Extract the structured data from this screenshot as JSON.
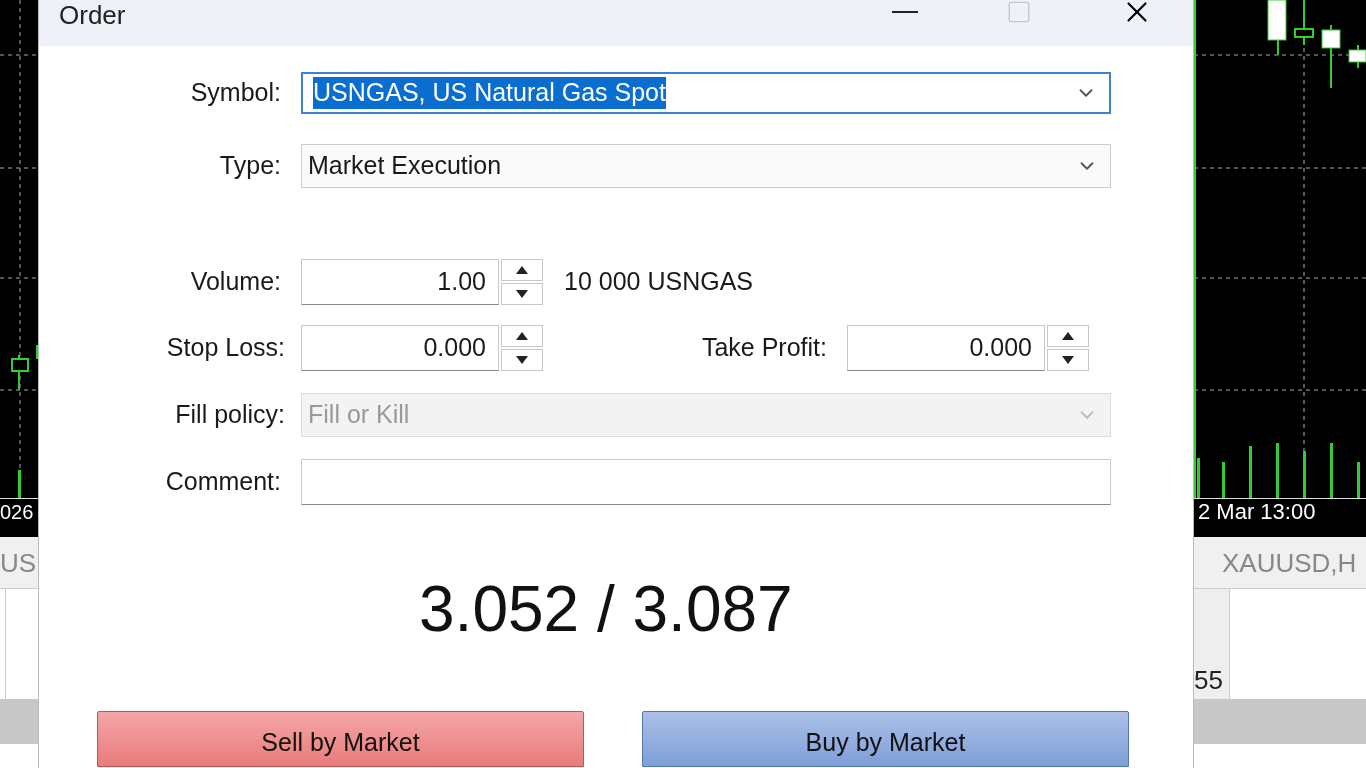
{
  "window": {
    "title": "Order"
  },
  "form": {
    "symbol": {
      "label": "Symbol:",
      "value": "USNGAS, US Natural Gas Spot",
      "text_selected": true
    },
    "type": {
      "label": "Type:",
      "value": "Market Execution"
    },
    "volume": {
      "label": "Volume:",
      "value": "1.00",
      "units": "10 000 USNGAS"
    },
    "stop_loss": {
      "label": "Stop Loss:",
      "value": "0.000"
    },
    "take_profit": {
      "label": "Take Profit:",
      "value": "0.000"
    },
    "fill_policy": {
      "label": "Fill policy:",
      "value": "Fill or Kill",
      "disabled": true
    },
    "comment": {
      "label": "Comment:"
    }
  },
  "quote": "3.052 / 3.087",
  "buttons": [
    {
      "label": "Sell by Market",
      "kind": "sell"
    },
    {
      "label": "Buy by Market",
      "kind": "buy"
    }
  ],
  "background": {
    "left": {
      "time_label": "026",
      "tab": "US"
    },
    "right": {
      "time_label": "2 Mar 13:00",
      "tab": "XAUUSD,H",
      "cell": "55"
    }
  }
}
